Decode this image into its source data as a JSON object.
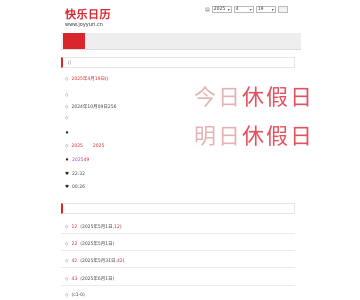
{
  "logo": {
    "text": "快乐日历",
    "site": "www.joyyuri.cn"
  },
  "picker": {
    "year": "2025",
    "month": "4",
    "day": "19",
    "go": ""
  },
  "nav": {
    "tabs": [
      "",
      "",
      "",
      "",
      "",
      "",
      ""
    ]
  },
  "section1": {
    "title": "()"
  },
  "rows1": [
    {
      "diamond": "◇",
      "prefix": "",
      "highlight": "2025年4月19日",
      "suffix": "()"
    },
    {
      "diamond": "◇",
      "prefix": "",
      "highlight": "",
      "suffix": ""
    },
    {
      "diamond": "◇",
      "prefix": "2024年10月09日",
      "highlight": "",
      "suffix": "256"
    },
    {
      "diamond": "◇",
      "prefix": "",
      "highlight": "",
      "suffix": ""
    },
    {
      "diamond": "◇",
      "prefix": "2025",
      "highlight": "",
      "suffix": "2025"
    },
    {
      "diamond": "♦",
      "prefix": "",
      "highlight": "",
      "suffix": ""
    },
    {
      "diamond": "♦",
      "prefix": "2025",
      "highlight": "49",
      "suffix": ""
    },
    {
      "diamond": "♥",
      "prefix": "",
      "highlight": "22:32",
      "suffix": ""
    },
    {
      "diamond": "♥",
      "prefix": "",
      "highlight": "00:26",
      "suffix": ""
    }
  ],
  "big_text": {
    "line1_gray": "今日",
    "line1_red": "休假日",
    "line2_gray": "明日",
    "line2_red": "休假日"
  },
  "section2": {
    "title": ""
  },
  "rows2": [
    {
      "prefix": "12",
      "date": "(2025年5月1日,",
      "highlight": "12",
      "close": ")"
    },
    {
      "prefix": "22",
      "date": "(2025年5月1日)",
      "highlight": "",
      "close": ""
    },
    {
      "prefix": "42",
      "date": "(2025年5月31日,",
      "highlight": "42",
      "close": ")"
    },
    {
      "prefix": "43",
      "date": "(2025年6月1日)",
      "highlight": "",
      "close": ""
    }
  ],
  "footer_row": {
    "text": "(c1-0)"
  },
  "colors": {
    "brand": "#d9262c",
    "link": "#6b6bd8",
    "purple": "#9a4bd4"
  }
}
